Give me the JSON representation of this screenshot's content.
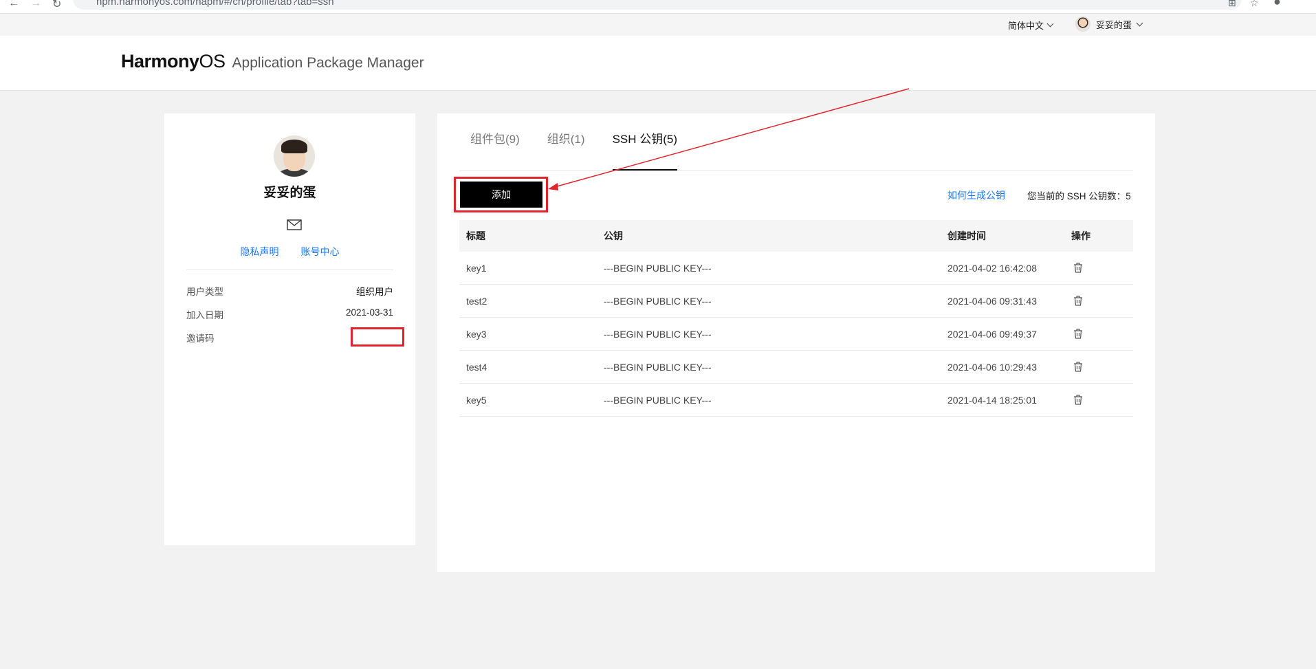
{
  "browser": {
    "url": "hpm.harmonyos.com/hapm/#/cn/profile/tab?tab=ssh"
  },
  "topbar": {
    "language": "简体中文",
    "username": "妥妥的蛋"
  },
  "header": {
    "brand_harmony": "Harmony",
    "brand_os": "OS",
    "product": "Application Package Manager"
  },
  "profile": {
    "name": "妥妥的蛋",
    "links": [
      "隐私声明",
      "账号中心"
    ],
    "info": [
      {
        "label": "用户类型",
        "value": "组织用户"
      },
      {
        "label": "加入日期",
        "value": "2021-03-31"
      },
      {
        "label": "邀请码",
        "value": ""
      }
    ]
  },
  "tabs": [
    {
      "label": "组件包(9)",
      "active": false
    },
    {
      "label": "组织(1)",
      "active": false
    },
    {
      "label": "SSH 公钥(5)",
      "active": true
    }
  ],
  "toolbar": {
    "add_label": "添加",
    "how_label": "如何生成公钥",
    "count_label": "您当前的 SSH 公钥数：5"
  },
  "table": {
    "headers": [
      "标题",
      "公钥",
      "创建时间",
      "操作"
    ],
    "rows": [
      {
        "title": "key1",
        "key": "---BEGIN PUBLIC KEY---",
        "created": "2021-04-02 16:42:08"
      },
      {
        "title": "test2",
        "key": "---BEGIN PUBLIC KEY---",
        "created": "2021-04-06 09:31:43"
      },
      {
        "title": "key3",
        "key": "---BEGIN PUBLIC KEY---",
        "created": "2021-04-06 09:49:37"
      },
      {
        "title": "test4",
        "key": "---BEGIN PUBLIC KEY---",
        "created": "2021-04-06 10:29:43"
      },
      {
        "title": "key5",
        "key": "---BEGIN PUBLIC KEY---",
        "created": "2021-04-14 18:25:01"
      }
    ]
  },
  "colors": {
    "accent_link": "#1476ff",
    "annotation_red": "#e0242e",
    "button_bg": "#000000"
  }
}
